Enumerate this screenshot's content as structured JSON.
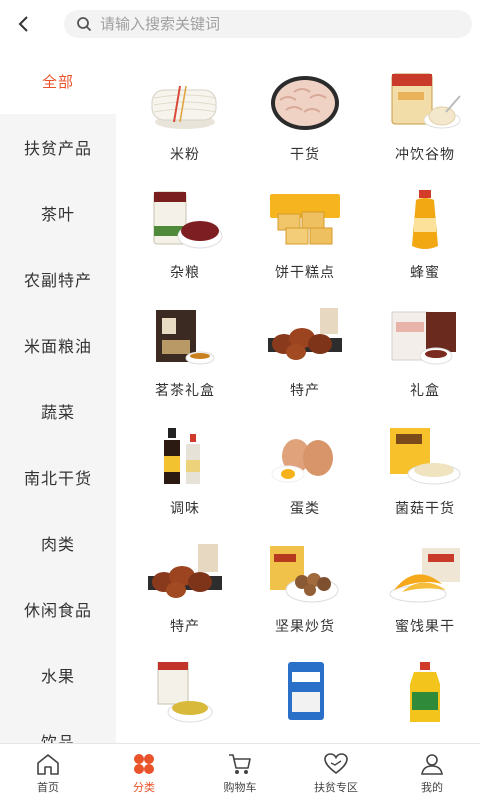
{
  "search": {
    "placeholder": "请输入搜索关键词"
  },
  "sidebar": {
    "items": [
      {
        "label": "全部"
      },
      {
        "label": "扶贫产品"
      },
      {
        "label": "茶叶"
      },
      {
        "label": "农副特产"
      },
      {
        "label": "米面粮油"
      },
      {
        "label": "蔬菜"
      },
      {
        "label": "南北干货"
      },
      {
        "label": "肉类"
      },
      {
        "label": "休闲食品"
      },
      {
        "label": "水果"
      },
      {
        "label": "饮品"
      }
    ],
    "active_index": 0
  },
  "categories": [
    {
      "label": "米粉",
      "image": "rice-noodle"
    },
    {
      "label": "干货",
      "image": "dried-goods"
    },
    {
      "label": "冲饮谷物",
      "image": "cereal-drink"
    },
    {
      "label": "杂粮",
      "image": "grains"
    },
    {
      "label": "饼干糕点",
      "image": "biscuits"
    },
    {
      "label": "蜂蜜",
      "image": "honey"
    },
    {
      "label": "茗茶礼盒",
      "image": "tea-gift-box"
    },
    {
      "label": "特产",
      "image": "specialty-meat"
    },
    {
      "label": "礼盒",
      "image": "gift-box"
    },
    {
      "label": "调味",
      "image": "seasoning"
    },
    {
      "label": "蛋类",
      "image": "eggs"
    },
    {
      "label": "菌菇干货",
      "image": "mushroom"
    },
    {
      "label": "特产",
      "image": "specialty-meat"
    },
    {
      "label": "坚果炒货",
      "image": "nuts"
    },
    {
      "label": "蜜饯果干",
      "image": "dried-fruit"
    },
    {
      "label": "",
      "image": "millet"
    },
    {
      "label": "",
      "image": "flour"
    },
    {
      "label": "",
      "image": "oil"
    }
  ],
  "tabbar": {
    "items": [
      {
        "label": "首页",
        "icon": "home-icon"
      },
      {
        "label": "分类",
        "icon": "category-icon"
      },
      {
        "label": "购物车",
        "icon": "cart-icon"
      },
      {
        "label": "扶贫专区",
        "icon": "poverty-relief-icon"
      },
      {
        "label": "我的",
        "icon": "profile-icon"
      }
    ],
    "active_index": 1
  },
  "colors": {
    "accent": "#e8532a",
    "sidebar_bg": "#f5f5f5",
    "search_bg": "#f3f3f3"
  }
}
